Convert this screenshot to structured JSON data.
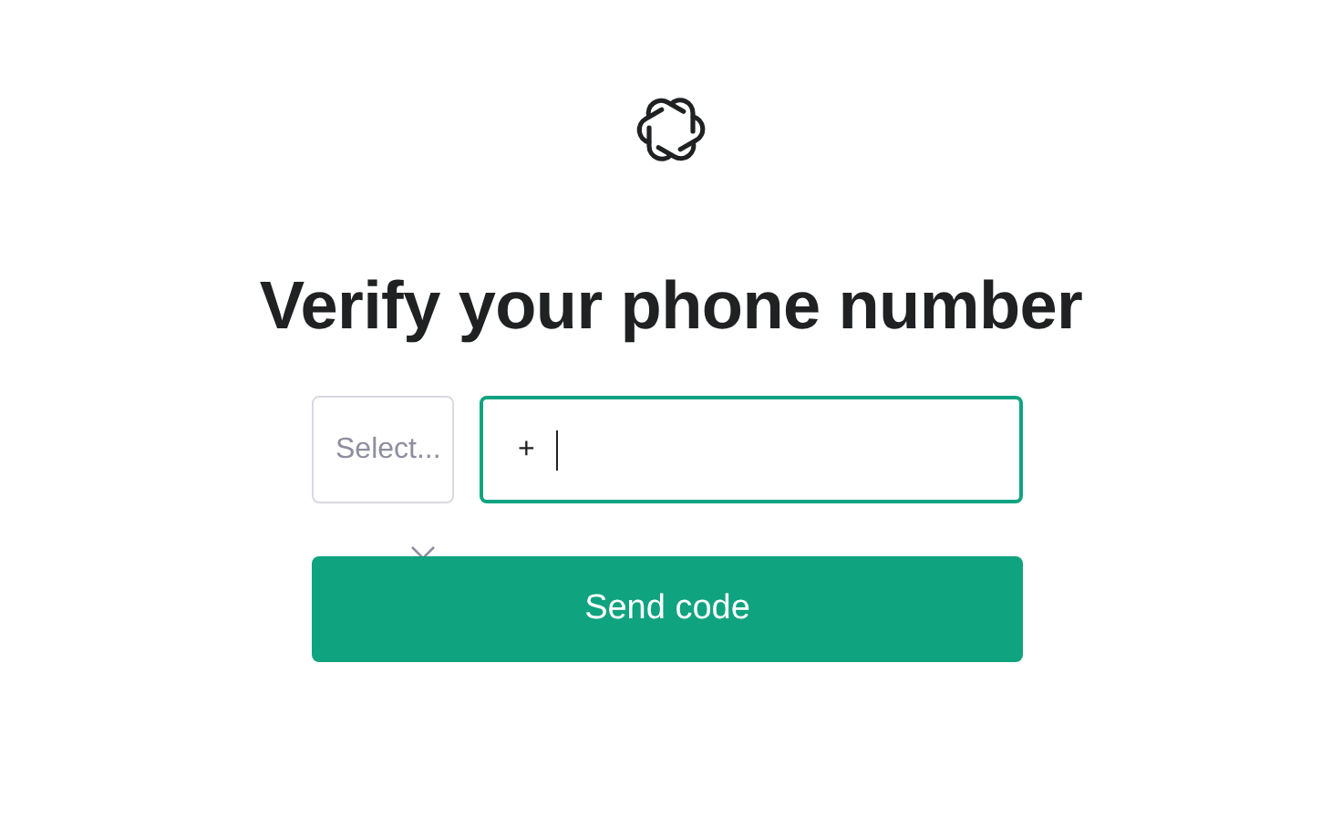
{
  "heading": "Verify your phone number",
  "country_select": {
    "placeholder": "Select..."
  },
  "phone_field": {
    "prefix": "+",
    "focused": true
  },
  "button": "Send code"
}
